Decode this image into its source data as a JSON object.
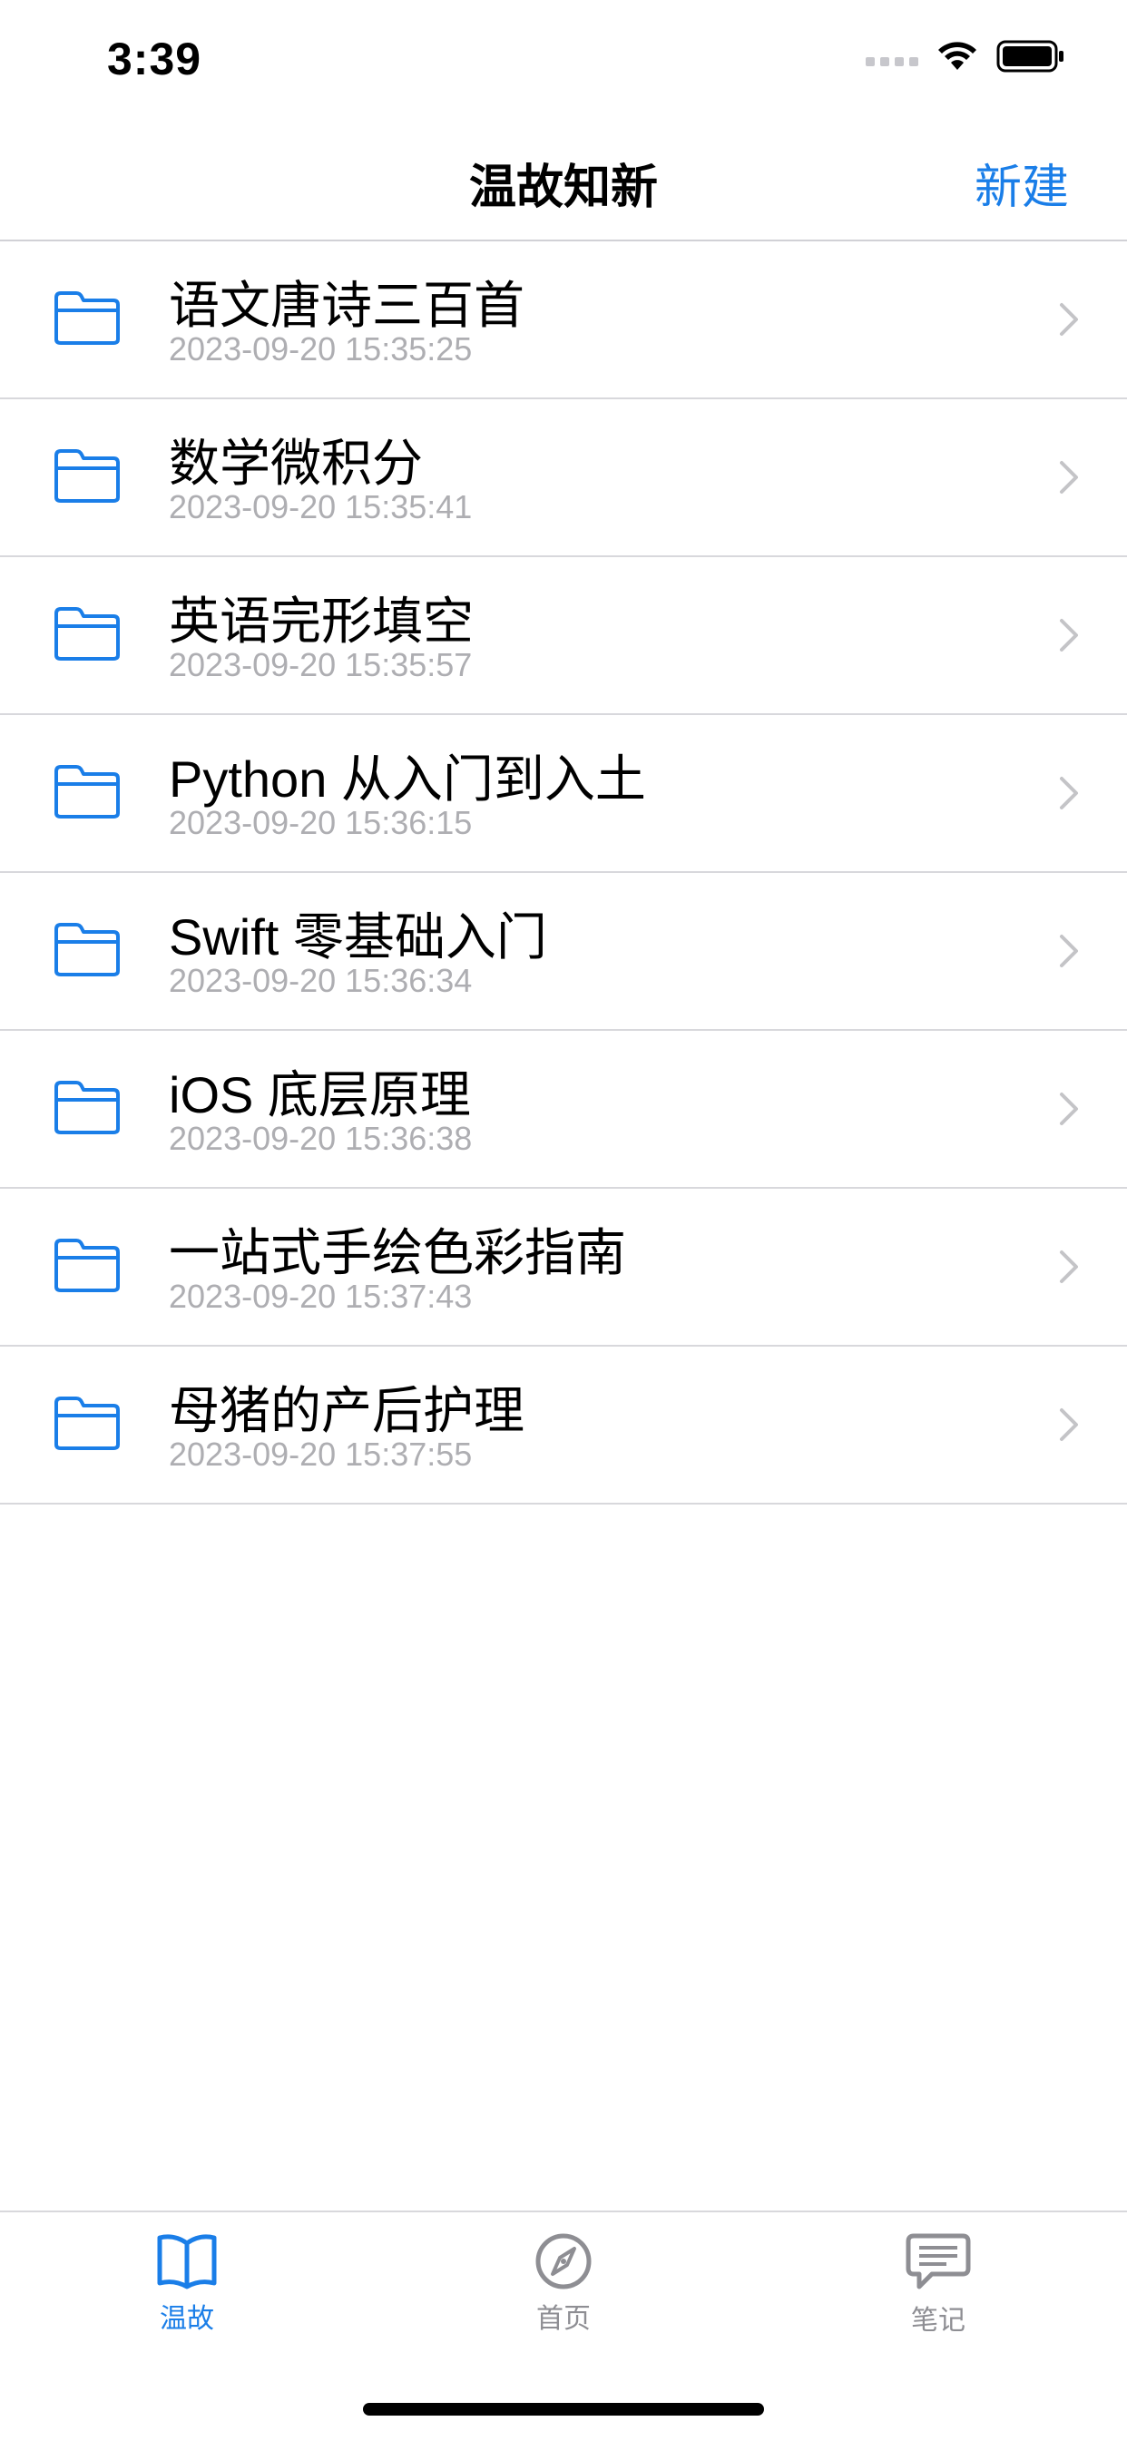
{
  "status_bar": {
    "time": "3:39"
  },
  "nav": {
    "title": "温故知新",
    "action_label": "新建"
  },
  "colors": {
    "accent": "#1a7ee8",
    "inactive": "#8e8e93",
    "subtitle": "#aeaeb2"
  },
  "list": {
    "items": [
      {
        "title": "语文唐诗三百首",
        "subtitle": "2023-09-20 15:35:25",
        "icon": "folder-icon"
      },
      {
        "title": "数学微积分",
        "subtitle": "2023-09-20 15:35:41",
        "icon": "folder-icon"
      },
      {
        "title": "英语完形填空",
        "subtitle": "2023-09-20 15:35:57",
        "icon": "folder-icon"
      },
      {
        "title": "Python 从入门到入土",
        "subtitle": "2023-09-20 15:36:15",
        "icon": "folder-icon"
      },
      {
        "title": "Swift 零基础入门",
        "subtitle": "2023-09-20 15:36:34",
        "icon": "folder-icon"
      },
      {
        "title": "iOS 底层原理",
        "subtitle": "2023-09-20 15:36:38",
        "icon": "folder-icon"
      },
      {
        "title": "一站式手绘色彩指南",
        "subtitle": "2023-09-20 15:37:43",
        "icon": "folder-icon"
      },
      {
        "title": "母猪的产后护理",
        "subtitle": "2023-09-20 15:37:55",
        "icon": "folder-icon"
      }
    ]
  },
  "tabs": [
    {
      "label": "温故",
      "icon": "book-icon",
      "active": true
    },
    {
      "label": "首页",
      "icon": "compass-icon",
      "active": false
    },
    {
      "label": "笔记",
      "icon": "message-icon",
      "active": false
    }
  ]
}
